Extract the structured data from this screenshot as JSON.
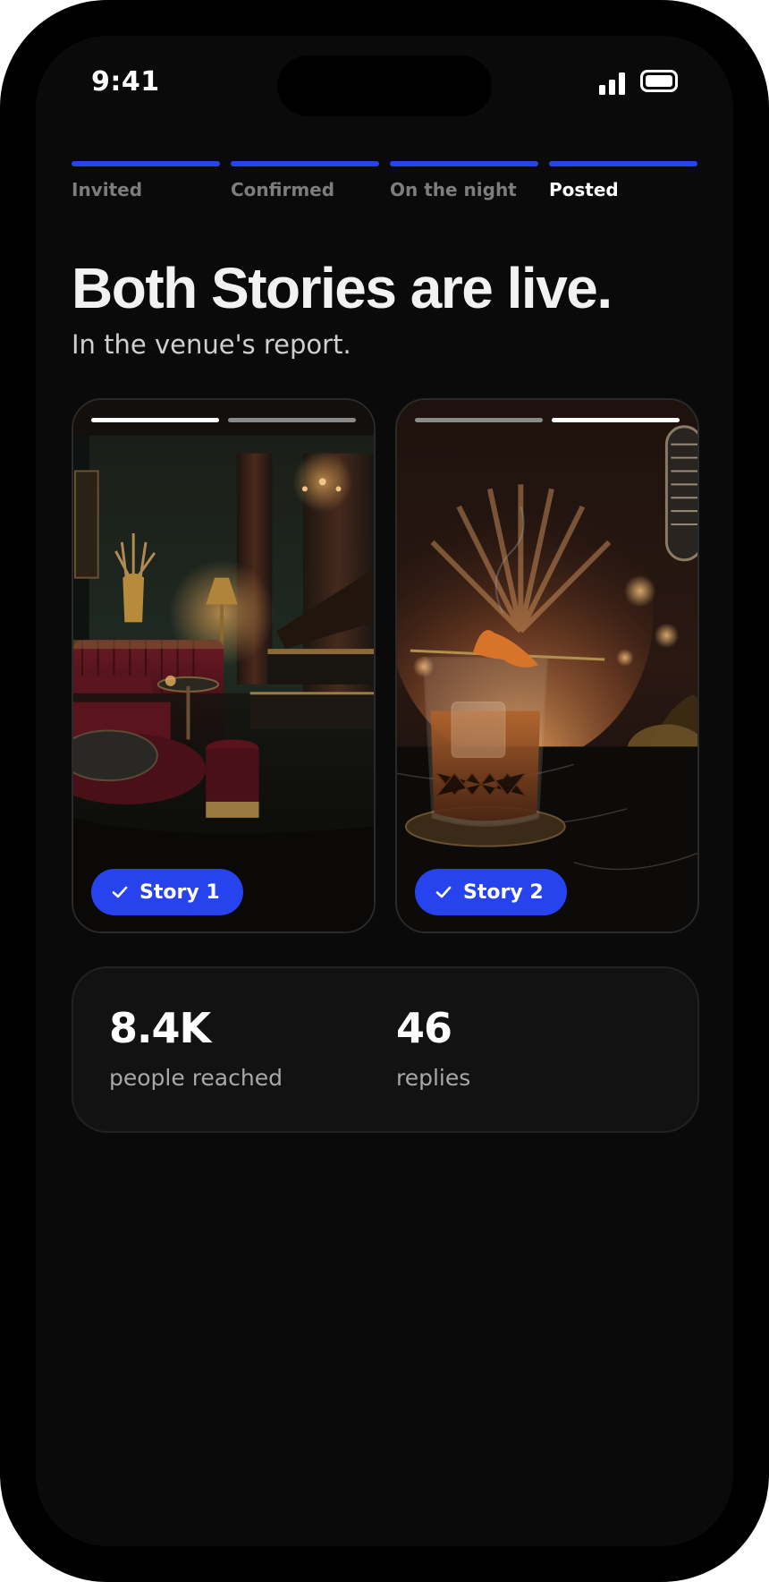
{
  "status_bar": {
    "time": "9:41"
  },
  "steps": [
    {
      "label": "Invited",
      "state": "done"
    },
    {
      "label": "Confirmed",
      "state": "done"
    },
    {
      "label": "On the night",
      "state": "done"
    },
    {
      "label": "Posted",
      "state": "current"
    }
  ],
  "headline": "Both Stories are live.",
  "subheadline": "In the venue's report.",
  "stories": [
    {
      "label": "Story 1",
      "status": "posted",
      "icon": "check-icon",
      "active_segment": 1
    },
    {
      "label": "Story 2",
      "status": "posted",
      "icon": "check-icon",
      "active_segment": 2
    }
  ],
  "stats": [
    {
      "value": "8.4K",
      "label": "people reached"
    },
    {
      "value": "46",
      "label": "replies"
    }
  ],
  "colors": {
    "accent": "#2743ee",
    "background": "#0a0a0a",
    "card": "#121212",
    "inactive_label": "#7d7d7d"
  }
}
